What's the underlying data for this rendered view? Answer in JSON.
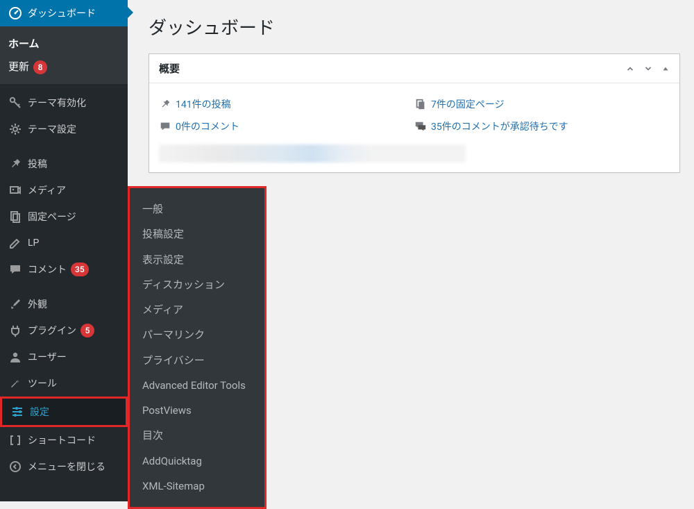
{
  "header": {
    "page_title": "ダッシュボード"
  },
  "sidebar": {
    "dashboard": "ダッシュボード",
    "home": "ホーム",
    "updates": "更新",
    "updates_badge": "8",
    "theme_activation": "テーマ有効化",
    "theme_settings": "テーマ設定",
    "posts": "投稿",
    "media": "メディア",
    "pages": "固定ページ",
    "lp": "LP",
    "comments": "コメント",
    "comments_badge": "35",
    "appearance": "外観",
    "plugins": "プラグイン",
    "plugins_badge": "5",
    "users": "ユーザー",
    "tools": "ツール",
    "settings": "設定",
    "shortcode": "ショートコード",
    "collapse": "メニューを閉じる"
  },
  "submenu": {
    "items": [
      "一般",
      "投稿設定",
      "表示設定",
      "ディスカッション",
      "メディア",
      "パーマリンク",
      "プライバシー",
      "Advanced Editor Tools",
      "PostViews",
      "目次",
      "AddQuicktag",
      "XML-Sitemap"
    ]
  },
  "panel": {
    "title": "概要",
    "post_count": "141件の投稿",
    "page_count": "7件の固定ページ",
    "comment_count": "0件のコメント",
    "pending_comments": "35件のコメントが承認待ちです"
  }
}
